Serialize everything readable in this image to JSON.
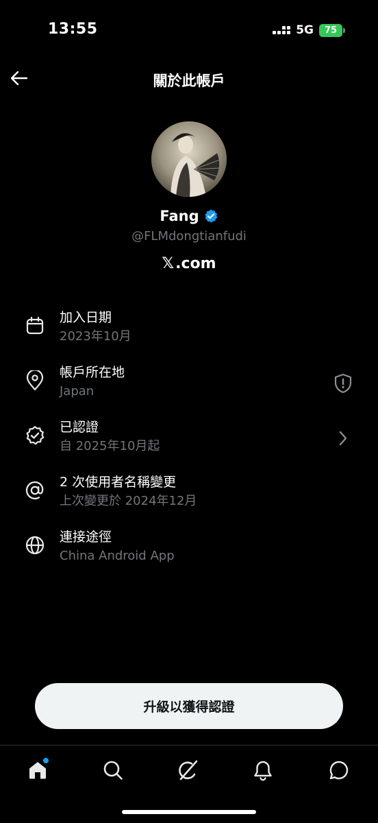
{
  "status_bar": {
    "time": "13:55",
    "network": "5G",
    "battery": "75"
  },
  "header": {
    "title": "關於此帳戶",
    "back_icon": "arrow-left-icon"
  },
  "profile": {
    "display_name": "Fang",
    "verified": true,
    "handle": "@FLMdongtianfudi",
    "domain_logo": "𝕏",
    "domain_suffix": ".com"
  },
  "info_rows": [
    {
      "icon": "calendar-icon",
      "title": "加入日期",
      "subtitle": "2023年10月"
    },
    {
      "icon": "location-pin-icon",
      "title": "帳戶所在地",
      "subtitle": "Japan",
      "trailing_icon": "shield-alert-icon"
    },
    {
      "icon": "verified-badge-icon",
      "title": "已認證",
      "subtitle": "自 2025年10月起",
      "trailing_icon": "chevron-right-icon"
    },
    {
      "icon": "at-sign-icon",
      "title": "2 次使用者名稱變更",
      "subtitle": "上次變更於 2024年12月"
    },
    {
      "icon": "globe-icon",
      "title": "連接途徑",
      "subtitle": "China Android App"
    }
  ],
  "upgrade_button": {
    "label": "升級以獲得認證"
  },
  "bottom_nav": {
    "items": [
      "home-icon",
      "search-icon",
      "grok-icon",
      "notifications-icon",
      "messages-icon"
    ],
    "active": "home-icon"
  },
  "colors": {
    "background": "#000000",
    "primary_text": "#e7e9ea",
    "secondary_text": "#71767b",
    "accent": "#1d9bf0",
    "battery": "#34c759"
  }
}
